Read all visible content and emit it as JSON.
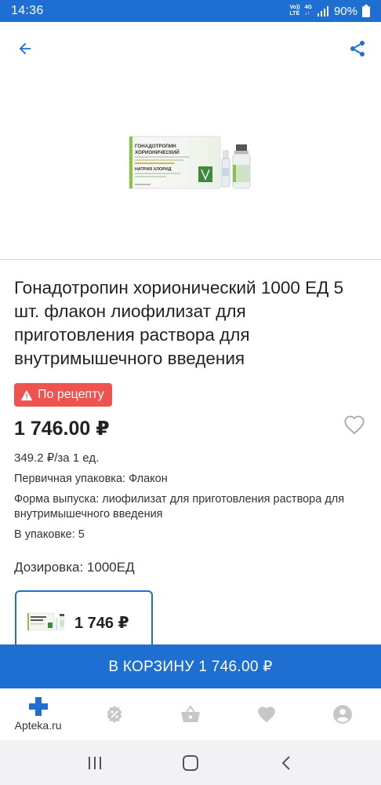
{
  "status_bar": {
    "time": "14:36",
    "net_top": "Vo))",
    "net_bottom": "LTE",
    "net_type": "4G",
    "battery": "90%"
  },
  "header": {
    "back_icon": "arrow-left-icon",
    "share_icon": "share-icon"
  },
  "product_image": {
    "box_title_1": "ГОНАДОТРОПИН",
    "box_title_2": "ХОРИОНИЧЕСКИЙ",
    "box_line_3": "НАТРИЯ ХЛОРИД"
  },
  "product": {
    "title": "Гонадотропин хорионический 1000 ЕД 5 шт. флакон лиофилизат для приготовления раствора для внутримышечного введения",
    "rx_badge": "По рецепту",
    "price": "1 746.00 ₽",
    "unit_price": "349.2 ₽/за 1 ед.",
    "primary_pack": "Первичная упаковка: Флакон",
    "release_form": "Форма выпуска: лиофилизат для приготовления раствора для внутримышечного введения",
    "in_pack": "В упаковке: 5",
    "dosage": "Дозировка: 1000ЕД"
  },
  "variant": {
    "price": "1 746 ₽"
  },
  "cart_button": {
    "label": "В КОРЗИНУ 1 746.00 ₽"
  },
  "bottom_nav": {
    "items": [
      {
        "label": "Apteka.ru",
        "icon": "plus-cross-icon"
      },
      {
        "label": "",
        "icon": "discount-badge-icon"
      },
      {
        "label": "",
        "icon": "basket-icon"
      },
      {
        "label": "",
        "icon": "heart-icon"
      },
      {
        "label": "",
        "icon": "account-icon"
      }
    ]
  },
  "colors": {
    "primary": "#1f6fd2",
    "rx_badge": "#ef5350",
    "nav_icon_inactive": "#c7c7c7"
  }
}
